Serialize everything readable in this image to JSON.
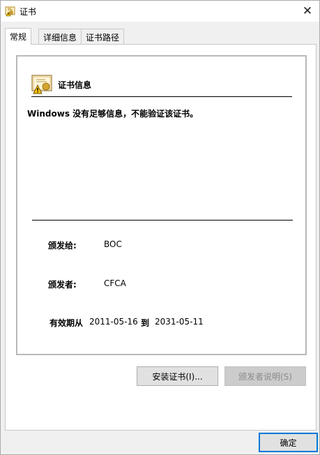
{
  "window": {
    "title": "证书",
    "close_glyph": "✕"
  },
  "tabs": [
    {
      "label": "常规"
    },
    {
      "label": "详细信息"
    },
    {
      "label": "证书路径"
    }
  ],
  "cert_info": {
    "heading": "证书信息",
    "warning": "Windows 没有足够信息，不能验证该证书。",
    "issued_to_label": "颁发给:",
    "issued_to_value": "BOC",
    "issued_by_label": "颁发者:",
    "issued_by_value": "CFCA",
    "validity_label": "有效期从",
    "valid_from": "2011-05-16",
    "to_label": "到",
    "valid_to": "2031-05-11"
  },
  "buttons": {
    "install": "安装证书(I)...",
    "issuer_statement": "颁发者说明(S)",
    "ok": "确定"
  },
  "icons": {
    "title_icon": "certificate-warning-icon",
    "cert_icon": "certificate-warning-icon"
  },
  "colors": {
    "ok_border": "#0078d7",
    "disabled_text": "#8a8a8a"
  }
}
